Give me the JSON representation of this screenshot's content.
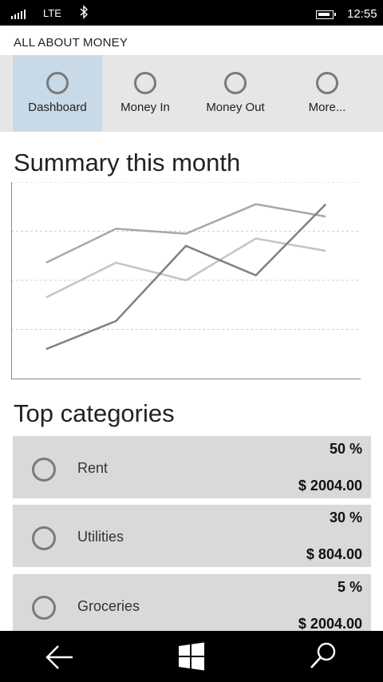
{
  "status": {
    "network": "LTE",
    "time": "12:55"
  },
  "app": {
    "title": "ALL ABOUT MONEY"
  },
  "nav": {
    "items": [
      {
        "label": "Dashboard",
        "active": true
      },
      {
        "label": "Money In",
        "active": false
      },
      {
        "label": "Money Out",
        "active": false
      },
      {
        "label": "More...",
        "active": false
      }
    ]
  },
  "summary": {
    "title": "Summary this month"
  },
  "chart_data": {
    "type": "line",
    "title": "Summary this month",
    "x": [
      1,
      2,
      3,
      4,
      5
    ],
    "ylim": [
      0,
      4
    ],
    "grid": true,
    "series": [
      {
        "values": [
          2.36,
          3.05,
          2.95,
          3.55,
          3.3
        ],
        "color": "#a8a8a8"
      },
      {
        "values": [
          1.65,
          2.36,
          2.0,
          2.85,
          2.6
        ],
        "color": "#c4c4c4"
      },
      {
        "values": [
          0.6,
          1.17,
          2.7,
          2.1,
          3.55
        ],
        "color": "#808080"
      }
    ]
  },
  "categories": {
    "title": "Top categories",
    "items": [
      {
        "name": "Rent",
        "percent": "50 %",
        "amount": "$ 2004.00"
      },
      {
        "name": "Utilities",
        "percent": "30 %",
        "amount": "$ 804.00"
      },
      {
        "name": "Groceries",
        "percent": "5 %",
        "amount": "$ 2004.00"
      }
    ]
  },
  "icons": {
    "status": [
      "signal-icon",
      "bluetooth-icon",
      "battery-icon"
    ],
    "bottom": [
      "back-arrow-icon",
      "windows-icon",
      "search-icon"
    ]
  }
}
